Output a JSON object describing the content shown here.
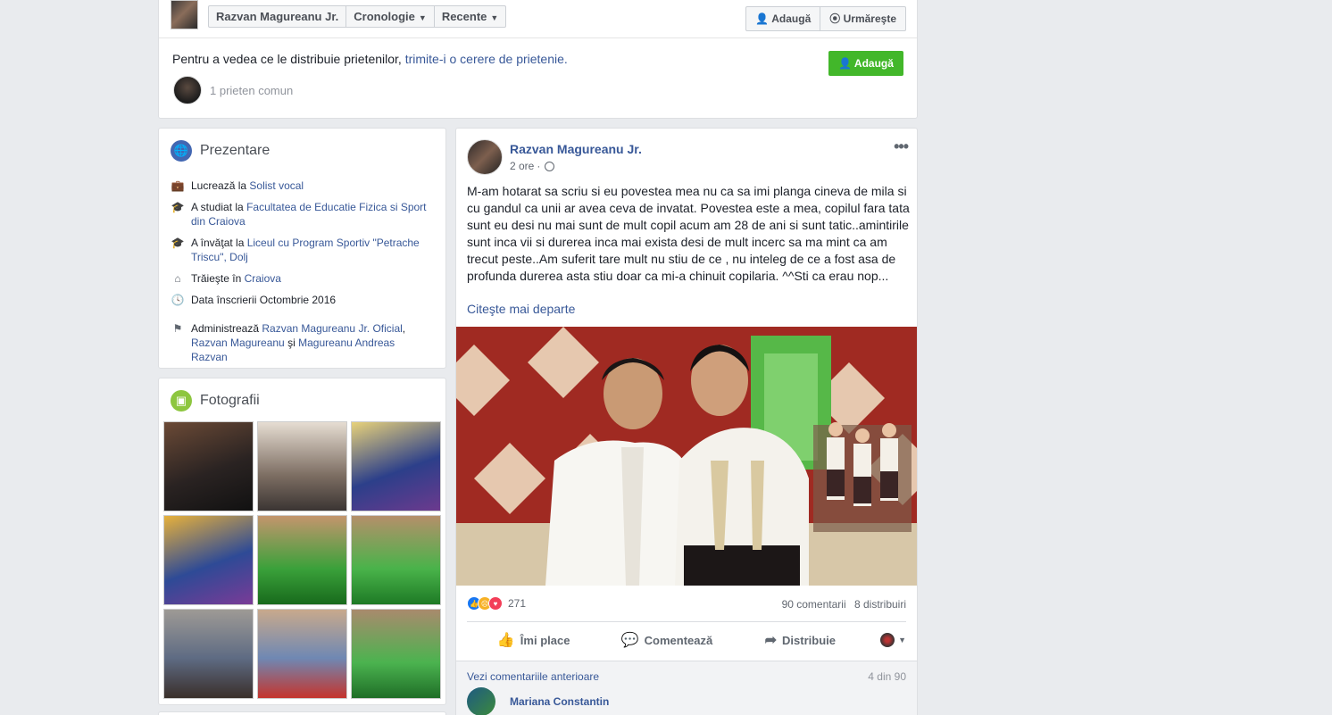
{
  "topbar": {
    "breadcrumbs": [
      "Razvan Magureanu Jr.",
      "Cronologie",
      "Recente"
    ],
    "add_label": "Adaugă",
    "follow_label": "Urmăreşte",
    "friend_prompt": "Pentru a vedea ce le distribuie prietenilor,",
    "friend_link": "trimite-i o cerere de prietenie.",
    "add_friend_label": "Adaugă",
    "mutual": "1 prieten comun"
  },
  "intro": {
    "title": "Prezentare",
    "work_prefix": "Lucrează la",
    "work_link": "Solist vocal",
    "study1_prefix": "A studiat la",
    "study1_link": "Facultatea de Educatie Fizica si Sport din Craiova",
    "study2_prefix": "A învăţat la",
    "study2_link": "Liceul cu Program Sportiv \"Petrache Triscu\", Dolj",
    "lives_prefix": "Trăieşte în",
    "lives_link": "Craiova",
    "joined": "Data înscrierii Octombrie 2016",
    "admin_prefix": "Administrează",
    "admin_link1": "Razvan Magureanu Jr. Oficial",
    "admin_link2": "Razvan Magureanu",
    "admin_and": "şi",
    "admin_link3": "Magureanu Andreas Razvan"
  },
  "photos": {
    "title": "Fotografii"
  },
  "post": {
    "author": "Razvan Magureanu Jr.",
    "time": "2 ore",
    "text": "M-am hotarat sa scriu si eu povestea mea nu ca sa imi planga cineva de mila si cu gandul ca unii ar avea ceva de invatat. Povestea este a mea, copilul fara tata sunt eu desi nu mai sunt de mult copil acum am 28 de ani si sunt tatic..amintirile sunt inca vii si durerea inca mai exista desi de mult incerc sa ma mint ca am trecut peste..Am suferit tare mult nu stiu de ce , nu inteleg de ce a fost asa de profunda durerea asta stiu doar ca mi-a chinuit copilaria. ^^Sti ca erau nop...",
    "see_more": "Citeşte mai departe",
    "reaction_count": "271",
    "comments": "90 comentarii",
    "shares": "8 distribuiri",
    "like_label": "Îmi place",
    "comment_label": "Comentează",
    "share_label": "Distribuie",
    "prev_comments": "Vezi comentariile anterioare",
    "comment_count": "4 din 90",
    "commenter": "Mariana Constantin"
  },
  "colors": {
    "link": "#385898",
    "green": "#42b72a",
    "background": "#e9ebee"
  }
}
